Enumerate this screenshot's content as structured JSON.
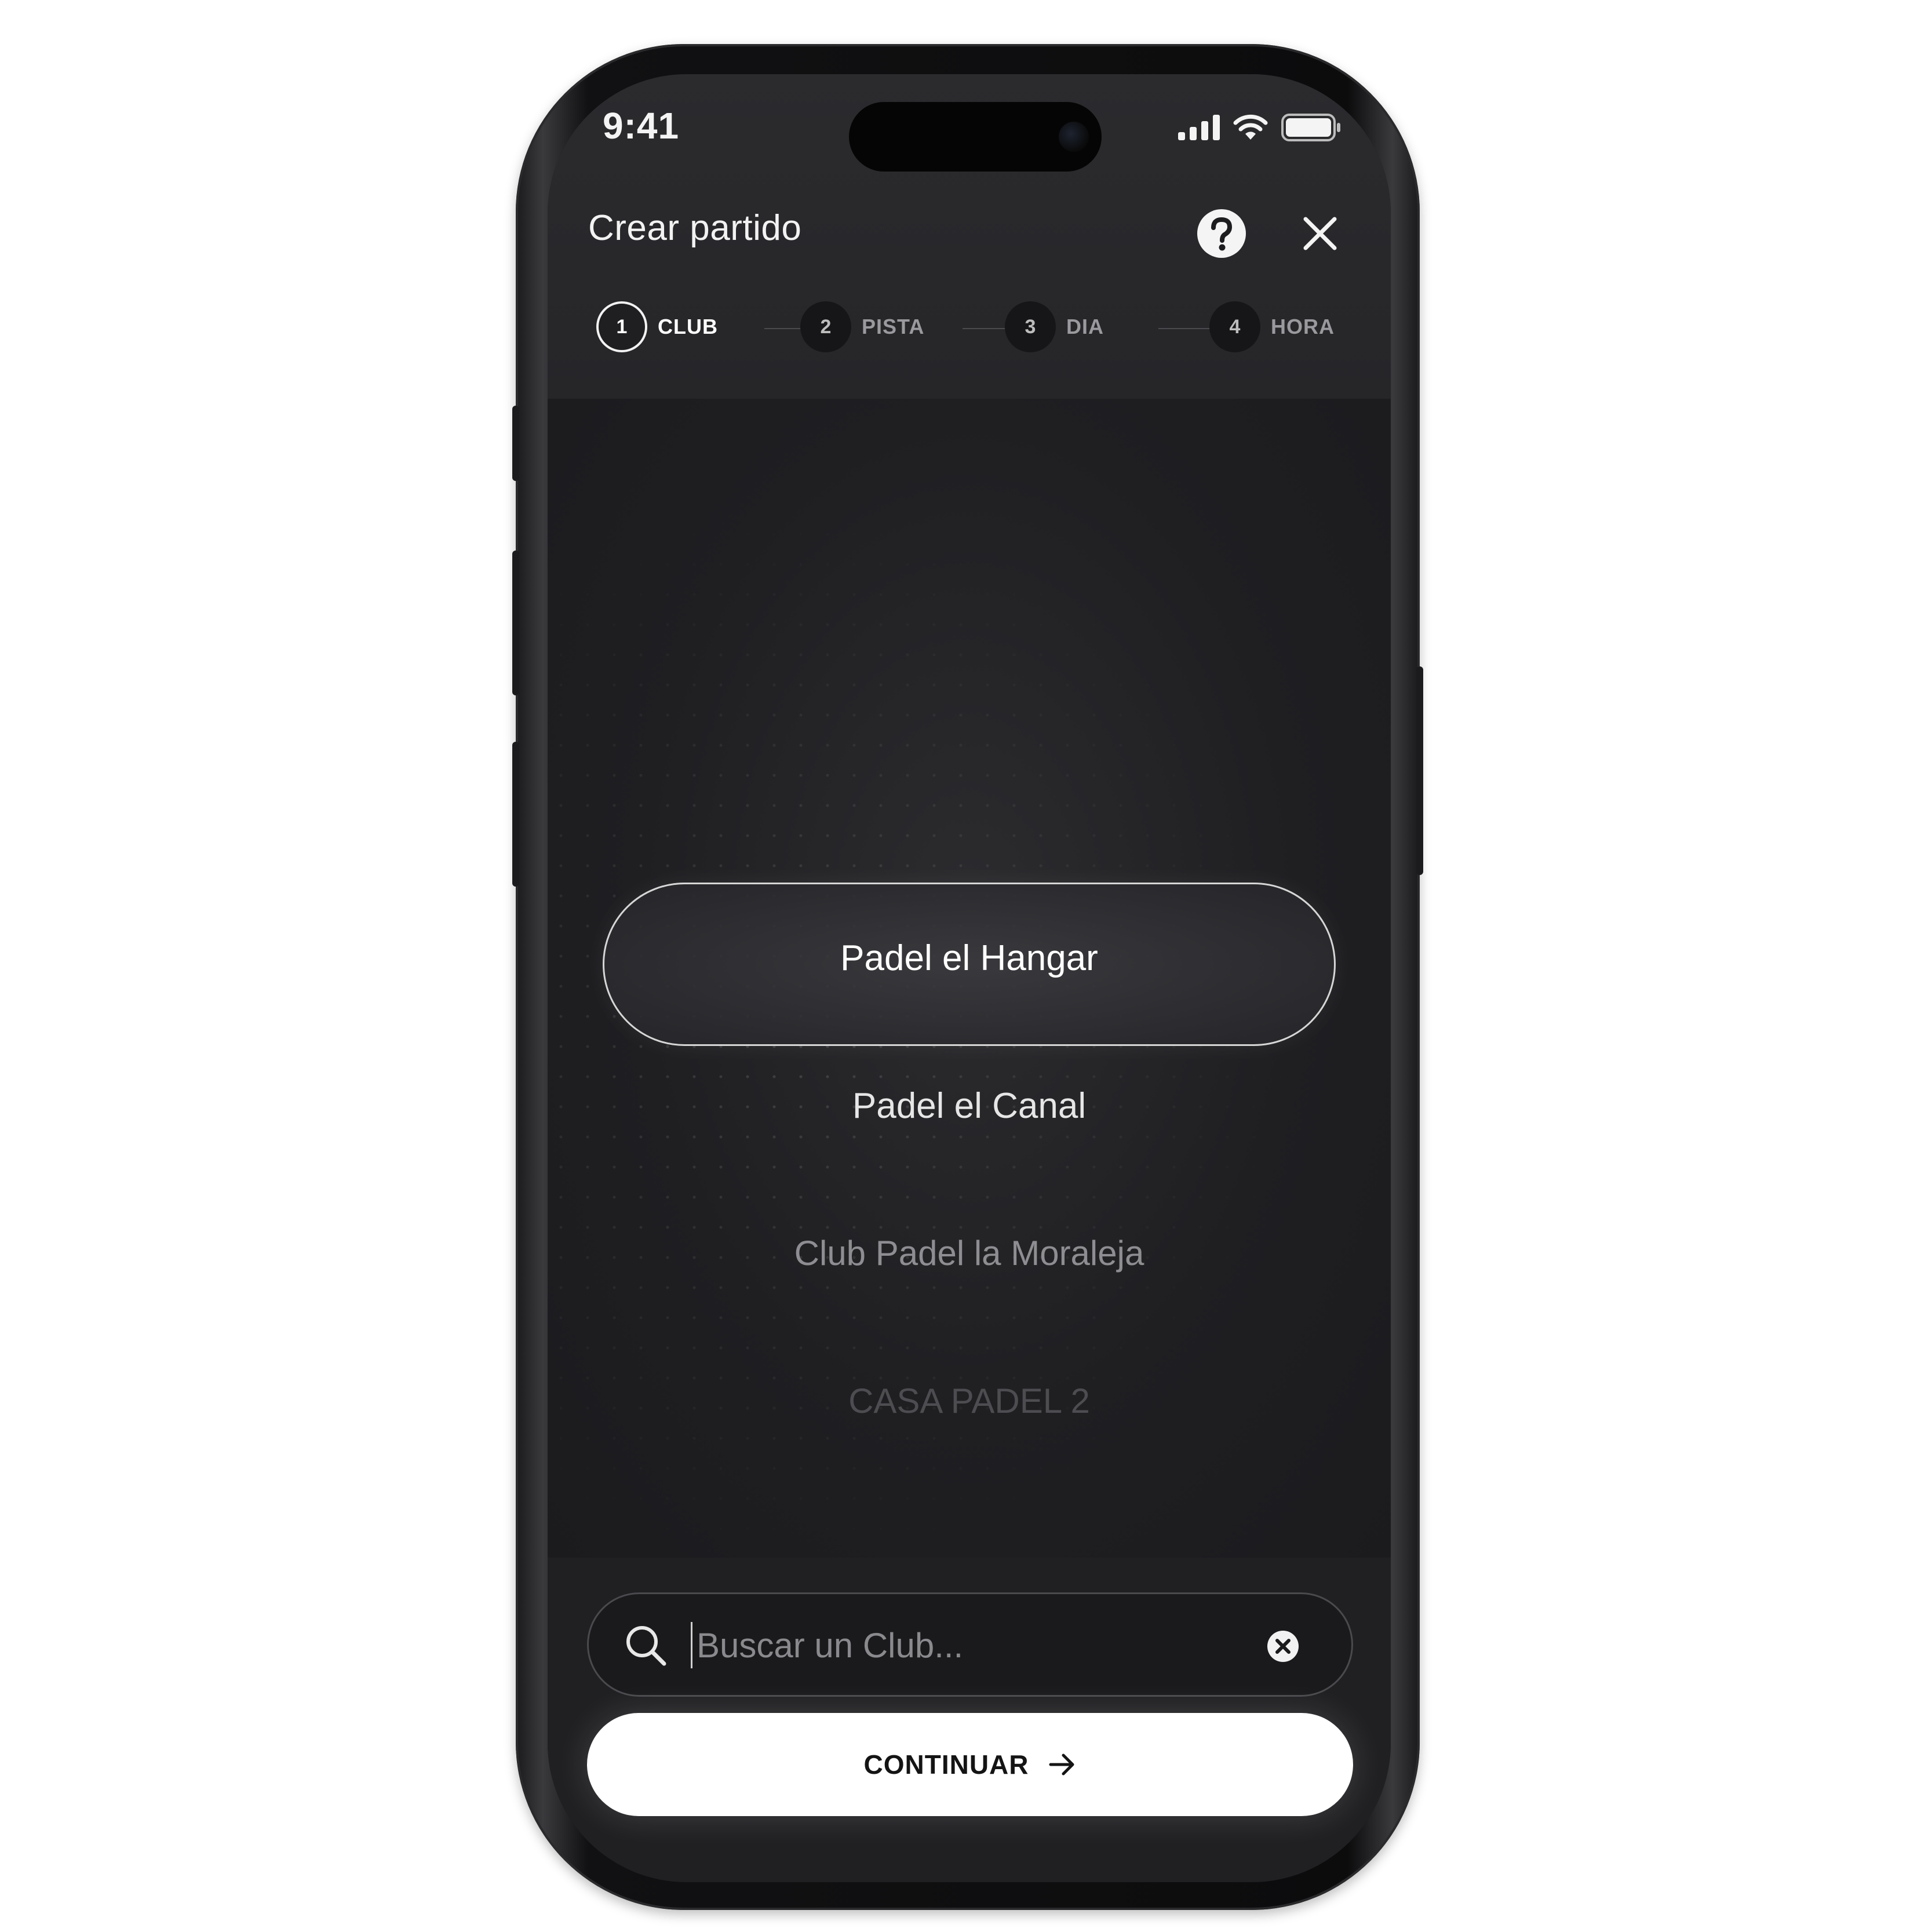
{
  "status_bar": {
    "time": "9:41"
  },
  "header": {
    "title": "Crear partido",
    "help_icon": "question-circle-icon",
    "close_icon": "close-icon"
  },
  "stepper": {
    "steps": [
      {
        "number": "1",
        "label": "CLUB",
        "active": true
      },
      {
        "number": "2",
        "label": "PISTA",
        "active": false
      },
      {
        "number": "3",
        "label": "DIA",
        "active": false
      },
      {
        "number": "4",
        "label": "HORA",
        "active": false
      }
    ]
  },
  "picker": {
    "selected": "Padel el Hangar",
    "items": [
      "Padel el Canal",
      "Club Padel la Moraleja",
      "CASA PADEL 2"
    ]
  },
  "search": {
    "placeholder": "Buscar un Club...",
    "value": ""
  },
  "continue_button": {
    "label": "CONTINUAR"
  },
  "colors": {
    "screen_bg": "#1d1d20",
    "accent": "#ffffff",
    "muted_text": "#9a9a9e"
  }
}
